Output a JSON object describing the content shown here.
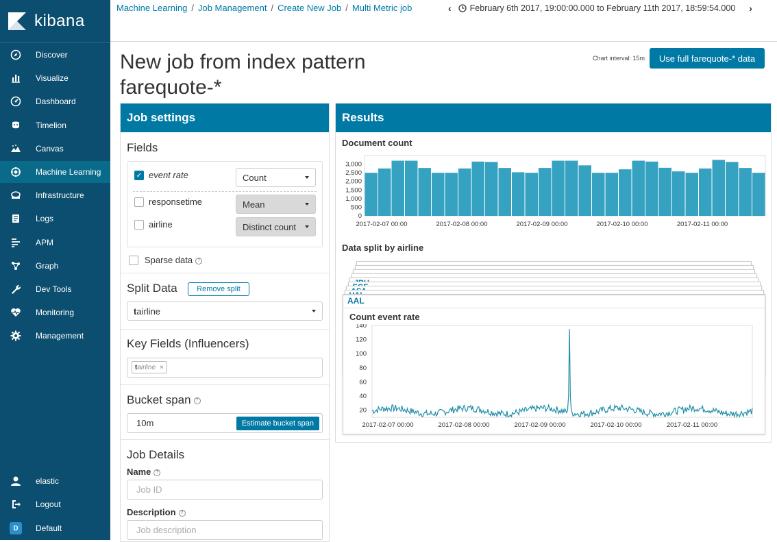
{
  "app": {
    "brand": "kibana"
  },
  "nav": [
    {
      "label": "Discover",
      "icon": "compass-icon"
    },
    {
      "label": "Visualize",
      "icon": "bar-chart-icon"
    },
    {
      "label": "Dashboard",
      "icon": "dashboard-icon"
    },
    {
      "label": "Timelion",
      "icon": "timelion-icon"
    },
    {
      "label": "Canvas",
      "icon": "canvas-icon"
    },
    {
      "label": "Machine Learning",
      "icon": "machine-learning-icon"
    },
    {
      "label": "Infrastructure",
      "icon": "infrastructure-icon"
    },
    {
      "label": "Logs",
      "icon": "logs-icon"
    },
    {
      "label": "APM",
      "icon": "apm-icon"
    },
    {
      "label": "Graph",
      "icon": "graph-icon"
    },
    {
      "label": "Dev Tools",
      "icon": "wrench-icon"
    },
    {
      "label": "Monitoring",
      "icon": "heartbeat-icon"
    },
    {
      "label": "Management",
      "icon": "gear-icon"
    }
  ],
  "nav_bottom": {
    "user": "elastic",
    "logout": "Logout",
    "space_initial": "D",
    "space": "Default"
  },
  "breadcrumbs": [
    "Machine Learning",
    "Job Management",
    "Create New Job",
    "Multi Metric job"
  ],
  "time_range": "February 6th 2017, 19:00:00.000 to February 11th 2017, 18:59:54.000",
  "page": {
    "title": "New job from index pattern farequote-*",
    "chart_interval": "Chart interval: 15m",
    "full_data_button": "Use full farequote-* data"
  },
  "job_settings": {
    "header": "Job settings",
    "fields_title": "Fields",
    "fields": [
      {
        "name": "event rate",
        "checked": true,
        "agg": "Count",
        "disabled": false
      },
      {
        "name": "responsetime",
        "checked": false,
        "agg": "Mean",
        "disabled": true
      },
      {
        "name": "airline",
        "checked": false,
        "agg": "Distinct count",
        "disabled": true
      }
    ],
    "sparse_data": "Sparse data",
    "split_title": "Split Data",
    "remove_split": "Remove split",
    "split_type_glyph": "t",
    "split_field": "airline",
    "key_fields_title": "Key Fields (Influencers)",
    "influencer_glyph": "t",
    "influencer": "airline",
    "bucket_span_title": "Bucket span",
    "bucket_span_value": "10m",
    "estimate_button": "Estimate bucket span",
    "job_details_title": "Job Details",
    "name_label": "Name",
    "name_placeholder": "Job ID",
    "description_label": "Description",
    "description_placeholder": "Job description"
  },
  "results": {
    "header": "Results",
    "doc_count_title": "Document count",
    "split_title": "Data split by airline",
    "stack_labels": [
      "JBU",
      "EGF",
      "ASA",
      "UAL",
      "AWE"
    ],
    "front_card_label": "AAL",
    "front_card_chart_title": "Count event rate"
  },
  "chart_data": [
    {
      "type": "bar",
      "title": "Document count",
      "x_ticks": [
        "2017-02-07 00:00",
        "2017-02-08 00:00",
        "2017-02-09 00:00",
        "2017-02-10 00:00",
        "2017-02-11 00:00"
      ],
      "y_ticks": [
        "3,000",
        "2,500",
        "2,000",
        "1,500",
        "1,000",
        "500",
        "0"
      ],
      "ylim": [
        0,
        3500
      ],
      "values": [
        2500,
        2750,
        3200,
        3200,
        2780,
        2500,
        2500,
        2750,
        3150,
        3130,
        2780,
        2530,
        2500,
        2780,
        3200,
        3200,
        2930,
        2500,
        2500,
        2700,
        3200,
        3150,
        2790,
        2580,
        2500,
        2750,
        3250,
        3130,
        2780,
        2500
      ],
      "color": "#36a2c2"
    },
    {
      "type": "line",
      "title": "Count event rate",
      "x_ticks": [
        "2017-02-07 00:00",
        "2017-02-08 00:00",
        "2017-02-09 00:00",
        "2017-02-10 00:00",
        "2017-02-11 00:00"
      ],
      "y_ticks": [
        "140",
        "120",
        "100",
        "80",
        "60",
        "40",
        "20"
      ],
      "ylim": [
        10,
        140
      ],
      "spike": {
        "x_fraction": 0.52,
        "value": 135
      },
      "baseline": 19,
      "color": "#1f8ea8"
    }
  ]
}
